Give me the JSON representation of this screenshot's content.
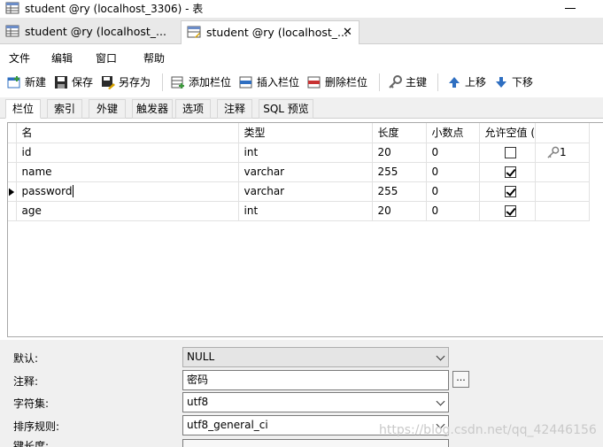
{
  "window": {
    "title": "student @ry (localhost_3306) - 表"
  },
  "doc_tabs": [
    {
      "label": "student @ry (localhost_..."
    },
    {
      "label": "student @ry (localhost_...",
      "close": "✕"
    }
  ],
  "menu": [
    "文件",
    "编辑",
    "窗口",
    "帮助"
  ],
  "toolbar": {
    "new": "新建",
    "save": "保存",
    "save_as": "另存为",
    "add_column": "添加栏位",
    "insert_column": "插入栏位",
    "delete_column": "删除栏位",
    "primary_key": "主键",
    "move_up": "上移",
    "move_down": "下移"
  },
  "subtabs": [
    "栏位",
    "索引",
    "外键",
    "触发器",
    "选项",
    "注释",
    "SQL 预览"
  ],
  "grid": {
    "headers": [
      "名",
      "类型",
      "长度",
      "小数点",
      "允许空值 (",
      ""
    ],
    "rows": [
      {
        "name": "id",
        "type": "int",
        "length": "20",
        "decimals": "0",
        "nullable": false,
        "key": "1"
      },
      {
        "name": "name",
        "type": "varchar",
        "length": "255",
        "decimals": "0",
        "nullable": true,
        "key": ""
      },
      {
        "name": "password",
        "type": "varchar",
        "length": "255",
        "decimals": "0",
        "nullable": true,
        "key": ""
      },
      {
        "name": "age",
        "type": "int",
        "length": "20",
        "decimals": "0",
        "nullable": true,
        "key": ""
      }
    ],
    "current_row": 2
  },
  "properties": {
    "default_label": "默认:",
    "default_value": "NULL",
    "comment_label": "注释:",
    "comment_value": "密码",
    "ellipsis": "...",
    "charset_label": "字符集:",
    "charset_value": "utf8",
    "collation_label": "排序规则:",
    "collation_value": "utf8_general_ci",
    "key_length_label": "键长度:"
  },
  "watermark": "https://blog.csdn.net/qq_42446156",
  "colors": {
    "key_icon": "#808080",
    "toolbar_blue": "#2f6fc1",
    "toolbar_green": "#3a9a3a",
    "toolbar_red": "#c83232"
  }
}
